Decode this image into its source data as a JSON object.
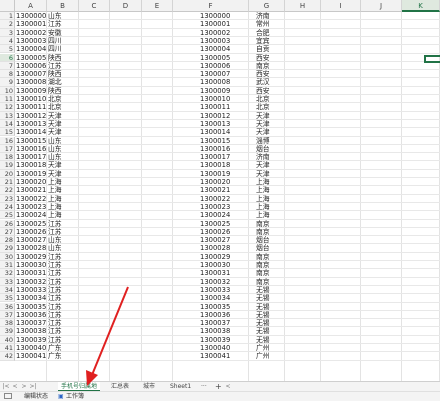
{
  "columns": [
    "A",
    "B",
    "C",
    "D",
    "E",
    "F",
    "G",
    "H",
    "I",
    "J",
    "K"
  ],
  "selected_column": "K",
  "selected_row": "6",
  "rows": [
    {
      "n": "1",
      "a": "1300000",
      "b": "山东",
      "f": "1300000",
      "g": "济南"
    },
    {
      "n": "2",
      "a": "1300001",
      "b": "江苏",
      "f": "1300001",
      "g": "常州"
    },
    {
      "n": "3",
      "a": "1300002",
      "b": "安徽",
      "f": "1300002",
      "g": "合肥"
    },
    {
      "n": "4",
      "a": "1300003",
      "b": "四川",
      "f": "1300003",
      "g": "宜宾"
    },
    {
      "n": "5",
      "a": "1300004",
      "b": "四川",
      "f": "1300004",
      "g": "自贡"
    },
    {
      "n": "6",
      "a": "1300005",
      "b": "陕西",
      "f": "1300005",
      "g": "西安"
    },
    {
      "n": "7",
      "a": "1300006",
      "b": "江苏",
      "f": "1300006",
      "g": "南京"
    },
    {
      "n": "8",
      "a": "1300007",
      "b": "陕西",
      "f": "1300007",
      "g": "西安"
    },
    {
      "n": "9",
      "a": "1300008",
      "b": "湖北",
      "f": "1300008",
      "g": "武汉"
    },
    {
      "n": "10",
      "a": "1300009",
      "b": "陕西",
      "f": "1300009",
      "g": "西安"
    },
    {
      "n": "11",
      "a": "1300010",
      "b": "北京",
      "f": "1300010",
      "g": "北京"
    },
    {
      "n": "12",
      "a": "1300011",
      "b": "北京",
      "f": "1300011",
      "g": "北京"
    },
    {
      "n": "13",
      "a": "1300012",
      "b": "天津",
      "f": "1300012",
      "g": "天津"
    },
    {
      "n": "14",
      "a": "1300013",
      "b": "天津",
      "f": "1300013",
      "g": "天津"
    },
    {
      "n": "15",
      "a": "1300014",
      "b": "天津",
      "f": "1300014",
      "g": "天津"
    },
    {
      "n": "16",
      "a": "1300015",
      "b": "山东",
      "f": "1300015",
      "g": "淄博"
    },
    {
      "n": "17",
      "a": "1300016",
      "b": "山东",
      "f": "1300016",
      "g": "烟台"
    },
    {
      "n": "18",
      "a": "1300017",
      "b": "山东",
      "f": "1300017",
      "g": "济南"
    },
    {
      "n": "19",
      "a": "1300018",
      "b": "天津",
      "f": "1300018",
      "g": "天津"
    },
    {
      "n": "20",
      "a": "1300019",
      "b": "天津",
      "f": "1300019",
      "g": "天津"
    },
    {
      "n": "21",
      "a": "1300020",
      "b": "上海",
      "f": "1300020",
      "g": "上海"
    },
    {
      "n": "22",
      "a": "1300021",
      "b": "上海",
      "f": "1300021",
      "g": "上海"
    },
    {
      "n": "23",
      "a": "1300022",
      "b": "上海",
      "f": "1300022",
      "g": "上海"
    },
    {
      "n": "24",
      "a": "1300023",
      "b": "上海",
      "f": "1300023",
      "g": "上海"
    },
    {
      "n": "25",
      "a": "1300024",
      "b": "上海",
      "f": "1300024",
      "g": "上海"
    },
    {
      "n": "26",
      "a": "1300025",
      "b": "江苏",
      "f": "1300025",
      "g": "南京"
    },
    {
      "n": "27",
      "a": "1300026",
      "b": "江苏",
      "f": "1300026",
      "g": "南京"
    },
    {
      "n": "28",
      "a": "1300027",
      "b": "山东",
      "f": "1300027",
      "g": "烟台"
    },
    {
      "n": "29",
      "a": "1300028",
      "b": "山东",
      "f": "1300028",
      "g": "烟台"
    },
    {
      "n": "30",
      "a": "1300029",
      "b": "江苏",
      "f": "1300029",
      "g": "南京"
    },
    {
      "n": "31",
      "a": "1300030",
      "b": "江苏",
      "f": "1300030",
      "g": "南京"
    },
    {
      "n": "32",
      "a": "1300031",
      "b": "江苏",
      "f": "1300031",
      "g": "南京"
    },
    {
      "n": "33",
      "a": "1300032",
      "b": "江苏",
      "f": "1300032",
      "g": "南京"
    },
    {
      "n": "34",
      "a": "1300033",
      "b": "江苏",
      "f": "1300033",
      "g": "无锡"
    },
    {
      "n": "35",
      "a": "1300034",
      "b": "江苏",
      "f": "1300034",
      "g": "无锡"
    },
    {
      "n": "36",
      "a": "1300035",
      "b": "江苏",
      "f": "1300035",
      "g": "无锡"
    },
    {
      "n": "37",
      "a": "1300036",
      "b": "江苏",
      "f": "1300036",
      "g": "无锡"
    },
    {
      "n": "38",
      "a": "1300037",
      "b": "江苏",
      "f": "1300037",
      "g": "无锡"
    },
    {
      "n": "39",
      "a": "1300038",
      "b": "江苏",
      "f": "1300038",
      "g": "无锡"
    },
    {
      "n": "40",
      "a": "1300039",
      "b": "江苏",
      "f": "1300039",
      "g": "无锡"
    },
    {
      "n": "41",
      "a": "1300040",
      "b": "广东",
      "f": "1300040",
      "g": "广州"
    },
    {
      "n": "42",
      "a": "1300041",
      "b": "广东",
      "f": "1300041",
      "g": "广州"
    }
  ],
  "sheet_tabs": [
    {
      "label": "手机号归属地",
      "active": true
    },
    {
      "label": "汇总表",
      "active": false
    },
    {
      "label": "城市",
      "active": false
    },
    {
      "label": "Sheet1",
      "active": false
    }
  ],
  "tab_more": "···",
  "tab_add": "+",
  "status": {
    "macro": "编辑状态",
    "helper": "工作簿"
  },
  "colors": {
    "accent": "#217346",
    "arrow": "#e02020"
  }
}
